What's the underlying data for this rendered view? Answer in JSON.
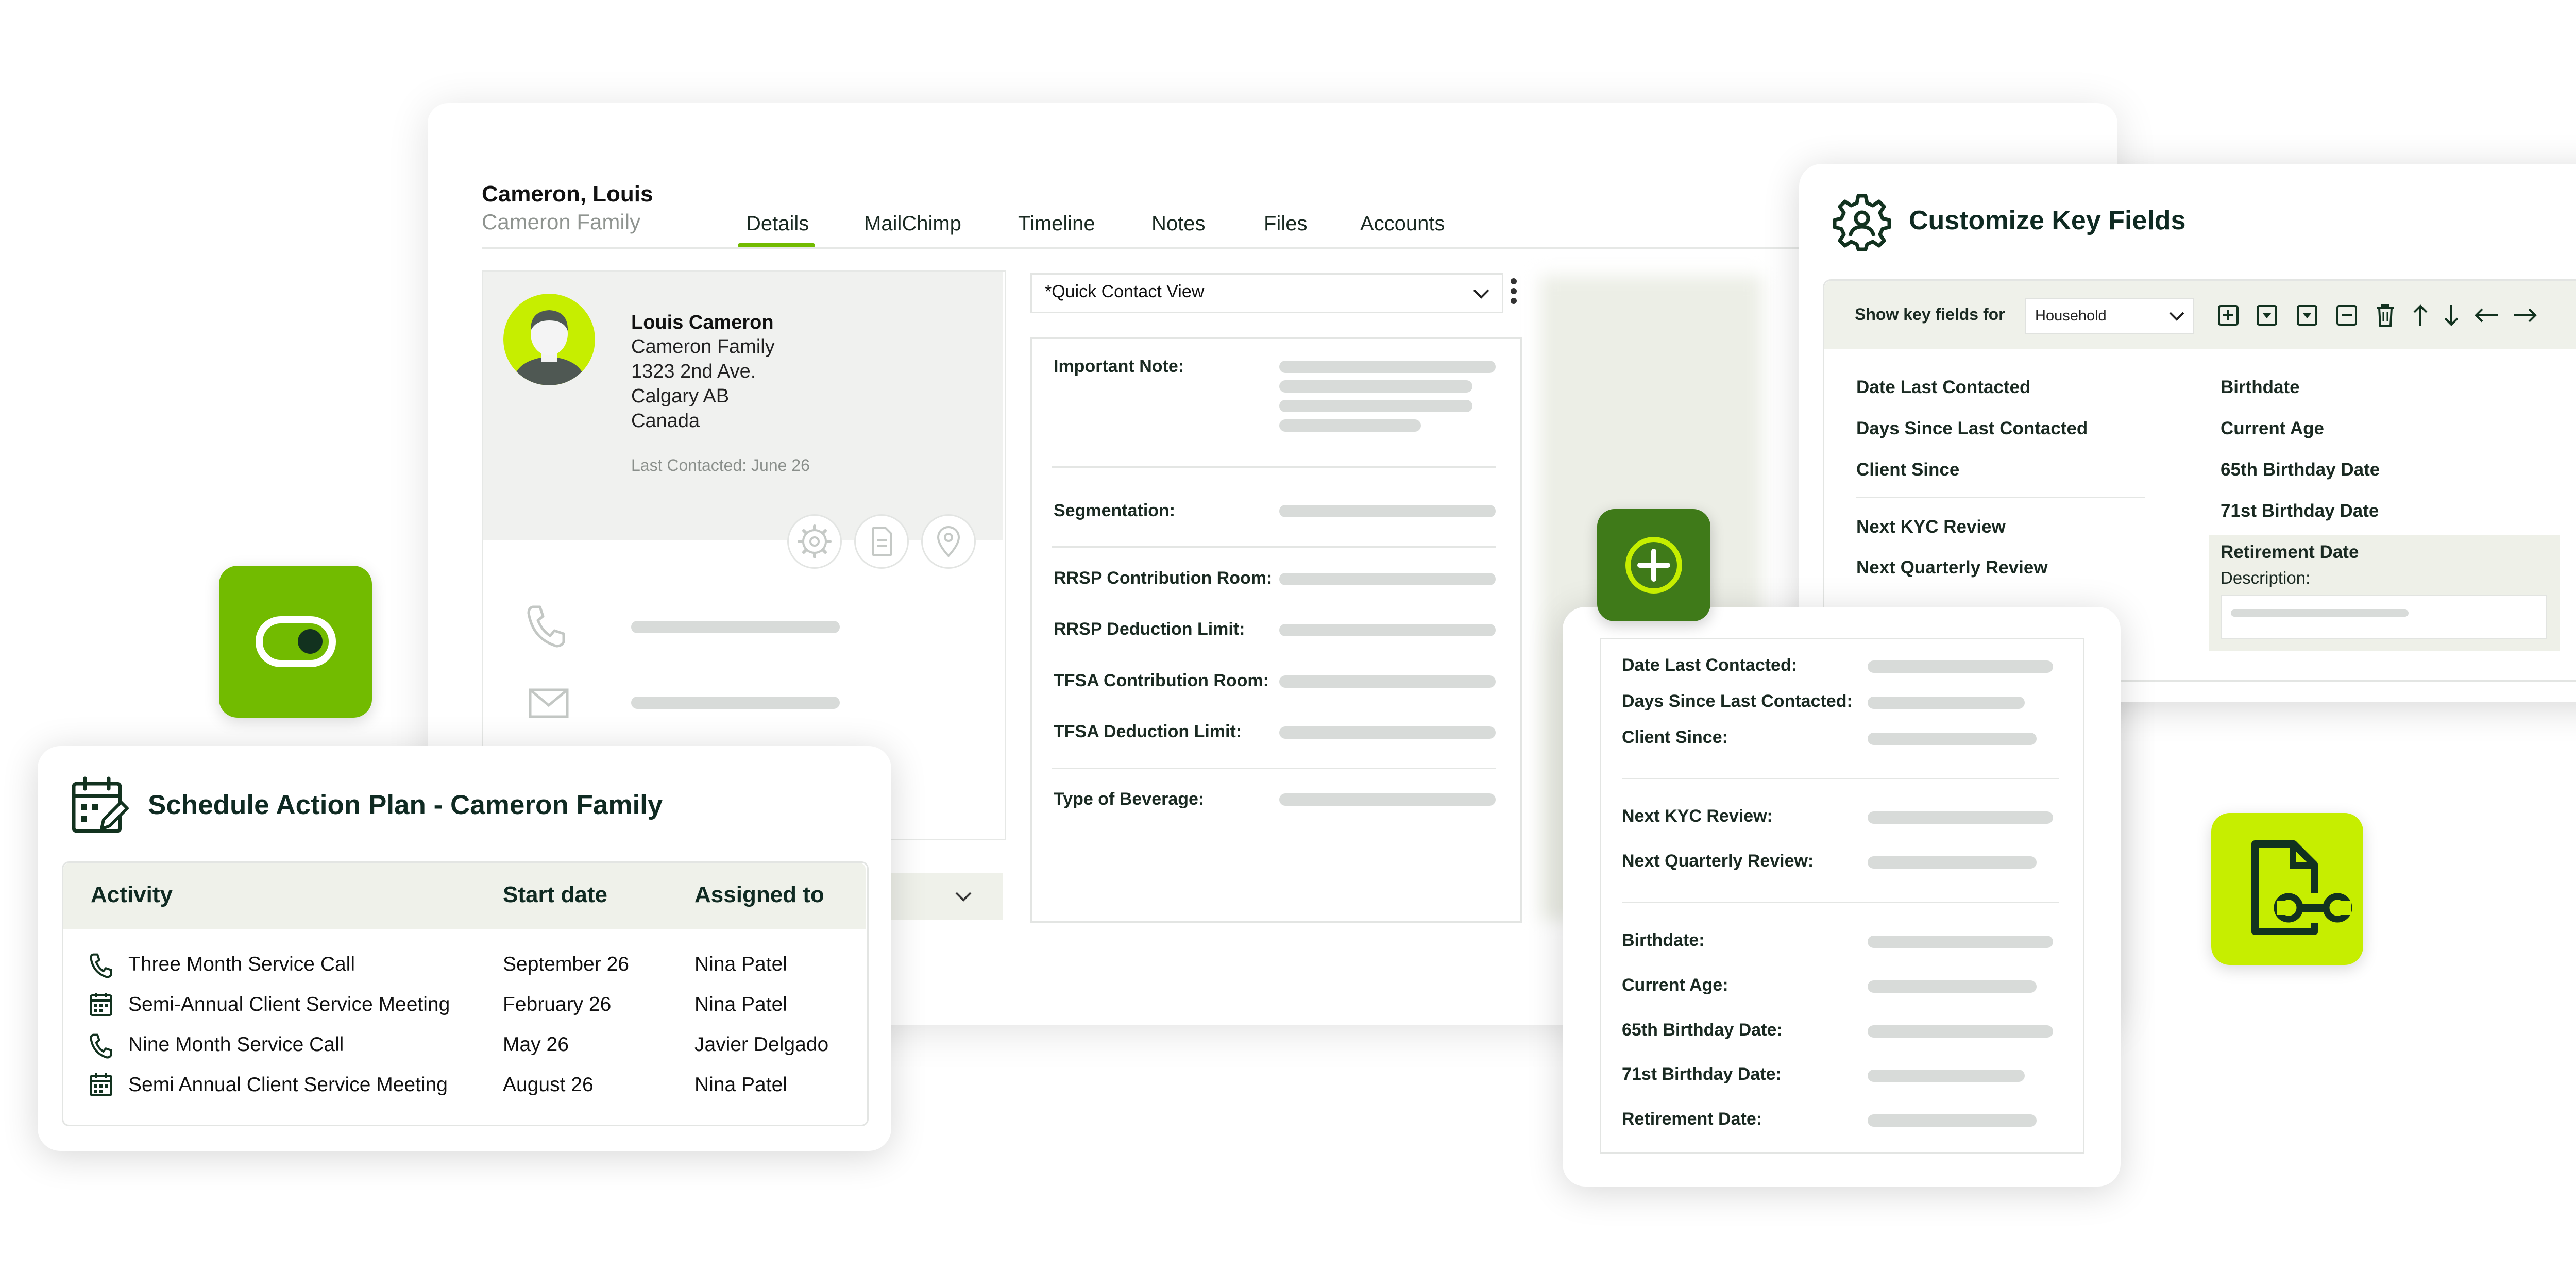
{
  "contact": {
    "name": "Cameron, Louis",
    "family": "Cameron Family",
    "tabs": [
      "Details",
      "MailChimp",
      "Timeline",
      "Notes",
      "Files",
      "Accounts"
    ],
    "active_tab": "Details",
    "card": {
      "name": "Louis Cameron",
      "family": "Cameron Family",
      "address1": "1323 2nd Ave.",
      "address2": "Calgary AB",
      "country": "Canada",
      "last_contacted": "Last Contacted: June 26"
    },
    "view_select": "*Quick Contact View",
    "fields": [
      "Important Note:",
      "Segmentation:",
      "RRSP Contribution Room:",
      "RRSP Deduction Limit:",
      "TFSA Contribution Room:",
      "TFSA Deduction Limit:",
      "Type of Beverage:"
    ]
  },
  "key_fields": {
    "title": "Customize Key Fields",
    "show_label": "Show key fields for",
    "select_value": "Household",
    "left": [
      "Date Last Contacted",
      "Days Since Last Contacted",
      "Client Since",
      "Next KYC Review",
      "Next Quarterly Review"
    ],
    "right": [
      "Birthdate",
      "Current Age",
      "65th Birthday Date",
      "71st Birthday Date",
      "Retirement Date"
    ],
    "description_label": "Description:"
  },
  "quick_fields": [
    "Date Last Contacted:",
    "Days Since Last Contacted:",
    "Client Since:",
    "Next KYC Review:",
    "Next Quarterly Review:",
    "Birthdate:",
    "Current Age:",
    "65th Birthday Date:",
    "71st Birthday Date:",
    "Retirement Date:"
  ],
  "schedule": {
    "title": "Schedule Action Plan - Cameron Family",
    "headers": [
      "Activity",
      "Start date",
      "Assigned to"
    ],
    "rows": [
      {
        "icon": "phone-icon",
        "activity": "Three Month Service Call",
        "start": "September 26",
        "assigned": "Nina Patel"
      },
      {
        "icon": "calendar-icon",
        "activity": "Semi-Annual Client Service Meeting",
        "start": "February 26",
        "assigned": "Nina Patel"
      },
      {
        "icon": "phone-icon",
        "activity": "Nine Month Service Call",
        "start": "May 26",
        "assigned": "Javier Delgado"
      },
      {
        "icon": "calendar-icon",
        "activity": "Semi Annual Client Service Meeting",
        "start": "August 26",
        "assigned": "Nina Patel"
      }
    ]
  },
  "colors": {
    "green": "#72bb00",
    "lime": "#c6ee00",
    "dark_green": "#3f7a19",
    "dark_text": "#0f2a22",
    "panel_bg": "#eff1ea"
  }
}
